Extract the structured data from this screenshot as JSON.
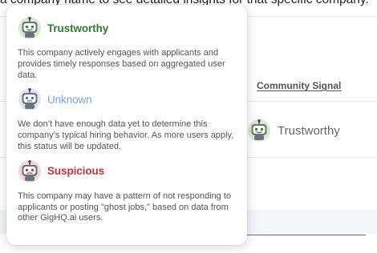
{
  "background": {
    "header_text": "a company name to see detailed insights for that specific company.",
    "column_header": "Community Signal",
    "row_status": {
      "label": "Trustworthy",
      "icon": "robot-green-icon"
    }
  },
  "popover": {
    "items": [
      {
        "title": "Trustworthy",
        "icon": "robot-green-icon",
        "color": "#2e7d32",
        "description": "This company actively engages with applicants and provides timely responses based on aggregated user data."
      },
      {
        "title": "Unknown",
        "icon": "robot-blue-icon",
        "color": "#7a9fe6",
        "description": "We don’t have enough data yet to determine this company’s typical hiring behavior. As more users apply, this status will be updated."
      },
      {
        "title": "Suspicious",
        "icon": "robot-red-icon",
        "color": "#c6313a",
        "description": "This company may have a pattern of not responding to applicants or posting \"ghost jobs,\" based on data from other GigHQ.ai users."
      }
    ]
  }
}
